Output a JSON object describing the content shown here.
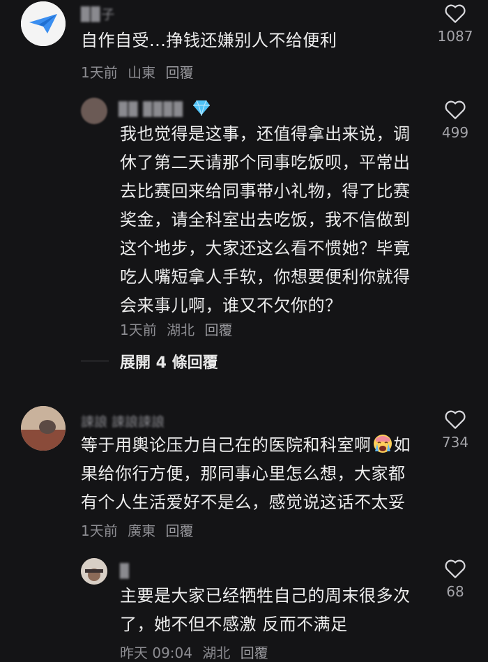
{
  "comments": [
    {
      "username": "▉▉子",
      "text": "自作自受...挣钱还嫌别人不给便利",
      "time": "1天前",
      "location": "山東",
      "reply": "回覆",
      "likes": "1087"
    },
    {
      "username": "▉▉ ▉▉▉▉",
      "text": "我也觉得是这事，还值得拿出来说，调休了第二天请那个同事吃饭呗，平常出去比赛回来给同事带小礼物，得了比赛奖金，请全科室出去吃饭，我不信做到这个地步，大家还这么看不惯她？毕竟吃人嘴短拿人手软，你想要便利你就得会来事儿啊，谁又不欠你的？",
      "time": "1天前",
      "location": "湖北",
      "reply": "回覆",
      "likes": "499"
    },
    {
      "username": "誎誏 誎誏誎誏",
      "text_before": "等于用輿论压力自己在的医院和科室啊",
      "text_after": "如果给你行方便，那同事心里怎么想，大家都有个人生活爱好不是么，感觉说这话不太妥",
      "emoji": "crying-face",
      "time": "1天前",
      "location": "廣東",
      "reply": "回覆",
      "likes": "734"
    },
    {
      "username": "▉",
      "text": "主要是大家已经牺牲自己的周末很多次了，她不但不感激 反而不满足",
      "time": "昨天 09:04",
      "location": "湖北",
      "reply": "回覆",
      "likes": "68"
    }
  ],
  "expand_replies": "展開 4 條回覆",
  "icons": {
    "like": "heart-outline-icon",
    "badge": "diamond-icon"
  },
  "colors": {
    "background": "#141416",
    "text": "#ededed",
    "muted": "#8d8d92",
    "diamond": "#4fc3f7"
  }
}
